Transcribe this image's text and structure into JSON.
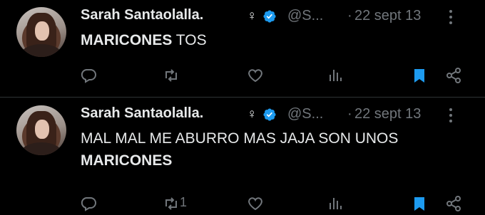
{
  "tweets": [
    {
      "name": "Sarah Santaolalla.",
      "gender_symbol": "♀",
      "handle": "@S...",
      "separator": "·",
      "date": "22 sept 13",
      "text_bold": "MARICONES",
      "text_rest": " TOS",
      "retweet_count": ""
    },
    {
      "name": "Sarah Santaolalla.",
      "gender_symbol": "♀",
      "handle": "@S...",
      "separator": "·",
      "date": "22 sept 13",
      "text_plain": "MAL MAL ME ABURRO MAS JAJA SON UNOS",
      "text_bold": "MARICONES",
      "retweet_count": "1"
    }
  ],
  "colors": {
    "background": "#000000",
    "text": "#e7e9ea",
    "secondary": "#71767b",
    "accent_blue": "#1d9bf0",
    "divider": "#2f3336"
  },
  "icons": [
    "reply-icon",
    "retweet-icon",
    "like-icon",
    "views-icon",
    "bookmark-icon",
    "share-icon",
    "verified-icon",
    "more-icon"
  ]
}
